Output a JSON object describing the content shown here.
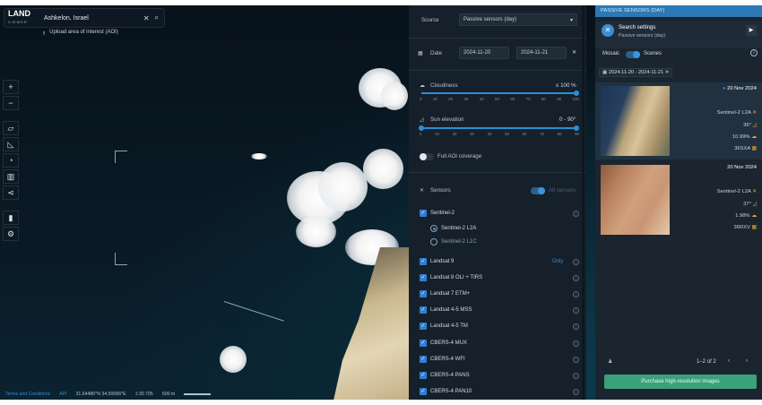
{
  "search": {
    "logo_text": "LAND",
    "logo_sub": "VIEWER",
    "value": "Ashkelon, Israel",
    "upload_label": "Upload area of interest (AOI)"
  },
  "toolbar": {
    "zoom_in": "+",
    "zoom_out": "−"
  },
  "bottom": {
    "terms": "Terms and Conditions",
    "api": "API",
    "coords": "31.64486°N 34.50086°E",
    "scale": "1:30 705",
    "scale_bar": "500 m"
  },
  "filters": {
    "source_label": "Source",
    "source_value": "Passive sensors (day)",
    "date_label": "Date",
    "date_from": "2024-11-20",
    "date_to": "2024-11-21",
    "cloudiness_label": "Cloudiness",
    "cloudiness_value": "≤ 100 %",
    "cloudiness_ticks": [
      "0",
      "10",
      "20",
      "30",
      "40",
      "50",
      "60",
      "70",
      "80",
      "90",
      "100"
    ],
    "sun_label": "Sun elevation",
    "sun_value": "0 - 90°",
    "sun_ticks": [
      "0",
      "10",
      "20",
      "30",
      "40",
      "50",
      "60",
      "70",
      "80",
      "90"
    ],
    "aoi_label": "Full AOI coverage",
    "sensors_label": "Sensors",
    "all_sensors_label": "All sensors",
    "sensors": [
      {
        "name": "Sentinel-2",
        "checked": true
      },
      {
        "name": "Landsat 9",
        "checked": true,
        "tag": "Only"
      },
      {
        "name": "Landsat 8 OLI + TIRS",
        "checked": true
      },
      {
        "name": "Landsat 7 ETM+",
        "checked": true
      },
      {
        "name": "Landsat 4-5 MSS",
        "checked": true
      },
      {
        "name": "Landsat 4-5 TM",
        "checked": true
      },
      {
        "name": "CBERS-4 MUX",
        "checked": true
      },
      {
        "name": "CBERS-4 WFI",
        "checked": true
      },
      {
        "name": "CBERS-4 PANS",
        "checked": true
      },
      {
        "name": "CBERS-4 PAN10",
        "checked": true
      }
    ],
    "sentinel_sub": [
      "Sentinel-2 L2A",
      "Sentinel-2 L1C"
    ]
  },
  "results": {
    "header": "PASSIVE SENSORS (DAY)",
    "settings_title": "Search settings",
    "settings_sub": "Passive sensors (day)",
    "mosaic_label": "Mosaic",
    "scenes_label": "Scenes",
    "date_chip": "2024-11-20 - 2024-11-21",
    "scenes": [
      {
        "date": "20 Nov 2024",
        "sensor": "Sentinel-2  L2A",
        "angle": "36°",
        "cloud": "10.99%",
        "tile": "36SXA"
      },
      {
        "date": "20 Nov 2024",
        "sensor": "Sentinel-2  L2A",
        "angle": "37°",
        "cloud": "1.98%",
        "tile": "36RXV"
      }
    ],
    "pagination": "1–2 of 2",
    "purchase_label": "Purchase high-resolution images"
  },
  "colors": {
    "accent": "#2b8fd7",
    "panel": "#16202b",
    "purchase": "#3aa178"
  }
}
